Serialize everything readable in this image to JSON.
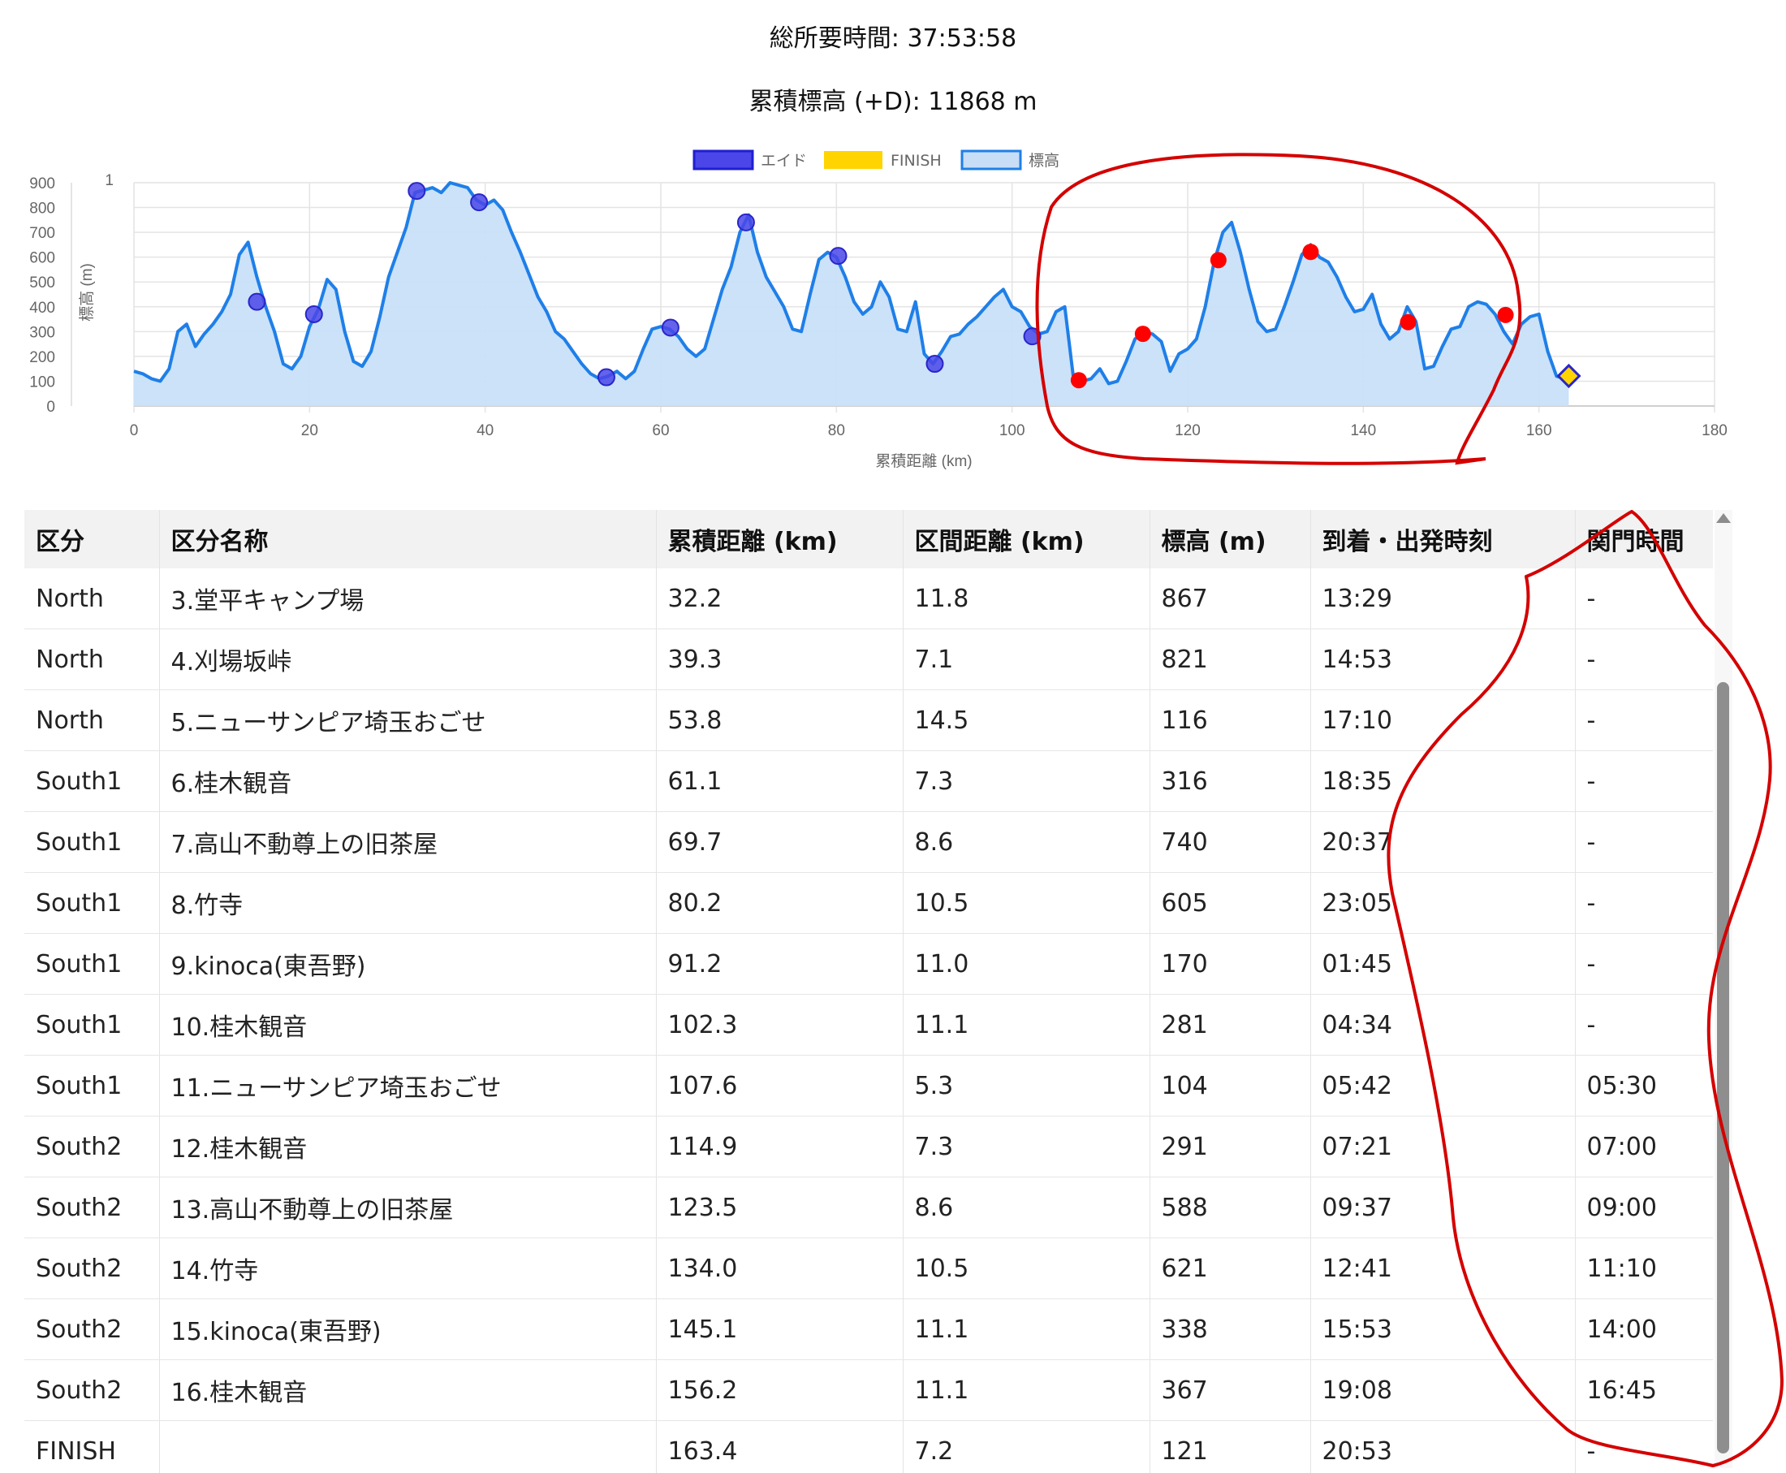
{
  "summary": {
    "total_time": "総所要時間: 37:53:58",
    "elevation_gain": "累積標高 (+D): 11868 m"
  },
  "chart": {
    "legend": [
      {
        "label": "エイド",
        "color": "#4a46e8"
      },
      {
        "label": "FINISH",
        "color": "#ffd400"
      },
      {
        "label": "標高",
        "color": "#c8def6"
      }
    ],
    "right_axis_tick": "1",
    "x_tick_labels": [
      "0",
      "20",
      "40",
      "60",
      "80",
      "100",
      "120",
      "140",
      "160",
      "180"
    ],
    "colors": {
      "line": "#1f7fe8",
      "fill": "#c8e0f8",
      "aid": "#4a46e8",
      "cutoff_aid": "#ff0000",
      "finish": "#ffd400"
    }
  },
  "chart_data": {
    "type": "area",
    "title": "",
    "xlabel": "累積距離 (km)",
    "ylabel": "標高 (m)",
    "xlim": [
      0,
      180
    ],
    "ylim": [
      0,
      900
    ],
    "y_ticks": [
      0,
      100,
      200,
      300,
      400,
      500,
      600,
      700,
      800,
      900
    ],
    "grid": true,
    "legend_position": "top",
    "series": [
      {
        "name": "標高",
        "x": [
          0,
          1,
          2,
          3,
          4,
          5,
          6,
          7,
          8,
          9,
          10,
          11,
          12,
          13,
          14,
          15,
          16,
          17,
          18,
          19,
          20,
          21,
          22,
          23,
          24,
          25,
          26,
          27,
          28,
          29,
          30,
          31,
          32,
          33,
          34,
          35,
          36,
          37,
          38,
          39,
          40,
          41,
          42,
          43,
          44,
          45,
          46,
          47,
          48,
          49,
          50,
          51,
          52,
          53,
          54,
          55,
          56,
          57,
          58,
          59,
          60,
          61,
          62,
          63,
          64,
          65,
          66,
          67,
          68,
          69,
          70,
          71,
          72,
          73,
          74,
          75,
          76,
          77,
          78,
          79,
          80,
          81,
          82,
          83,
          84,
          85,
          86,
          87,
          88,
          89,
          90,
          91,
          92,
          93,
          94,
          95,
          96,
          97,
          98,
          99,
          100,
          101,
          102,
          103,
          104,
          105,
          106,
          107,
          108,
          109,
          110,
          111,
          112,
          113,
          114,
          115,
          116,
          117,
          118,
          119,
          120,
          121,
          122,
          123,
          124,
          125,
          126,
          127,
          128,
          129,
          130,
          131,
          132,
          133,
          134,
          135,
          136,
          137,
          138,
          139,
          140,
          141,
          142,
          143,
          144,
          145,
          146,
          147,
          148,
          149,
          150,
          151,
          152,
          153,
          154,
          155,
          156,
          157,
          158,
          159,
          160,
          161,
          162,
          163,
          163.4
        ],
        "y": [
          140,
          130,
          110,
          100,
          150,
          300,
          330,
          240,
          290,
          330,
          380,
          450,
          610,
          660,
          520,
          400,
          300,
          170,
          150,
          200,
          320,
          390,
          510,
          470,
          300,
          180,
          160,
          220,
          360,
          520,
          620,
          720,
          860,
          870,
          880,
          860,
          900,
          890,
          880,
          830,
          810,
          830,
          790,
          700,
          620,
          530,
          440,
          380,
          300,
          270,
          220,
          170,
          130,
          110,
          120,
          140,
          110,
          140,
          230,
          310,
          320,
          310,
          280,
          230,
          200,
          230,
          350,
          470,
          560,
          700,
          770,
          620,
          520,
          460,
          400,
          310,
          300,
          450,
          590,
          620,
          600,
          520,
          420,
          370,
          400,
          500,
          440,
          310,
          300,
          420,
          210,
          170,
          220,
          280,
          290,
          330,
          360,
          400,
          440,
          470,
          400,
          380,
          320,
          290,
          300,
          380,
          400,
          110,
          100,
          110,
          150,
          90,
          100,
          180,
          270,
          300,
          290,
          260,
          140,
          210,
          230,
          270,
          400,
          580,
          700,
          740,
          620,
          470,
          340,
          300,
          310,
          400,
          500,
          610,
          650,
          600,
          580,
          520,
          440,
          380,
          390,
          450,
          330,
          270,
          300,
          400,
          340,
          150,
          160,
          240,
          310,
          320,
          400,
          420,
          410,
          370,
          300,
          250,
          330,
          360,
          370,
          220,
          120,
          110,
          121
        ]
      },
      {
        "name": "エイド",
        "x": [
          14,
          20.5,
          32.2,
          39.3,
          53.8,
          61.1,
          69.7,
          80.2,
          91.2,
          102.3
        ],
        "y": [
          420,
          370,
          867,
          821,
          116,
          316,
          740,
          605,
          170,
          281
        ]
      },
      {
        "name": "エイド (関門)",
        "x": [
          107.6,
          114.9,
          123.5,
          134.0,
          145.1,
          156.2
        ],
        "y": [
          104,
          291,
          588,
          621,
          338,
          367
        ]
      },
      {
        "name": "FINISH",
        "x": [
          163.4
        ],
        "y": [
          121
        ]
      }
    ]
  },
  "table": {
    "headers": [
      "区分",
      "区分名称",
      "累積距離 (km)",
      "区間距離 (km)",
      "標高 (m)",
      "到着・出発時刻",
      "関門時間"
    ],
    "rows": [
      [
        "North",
        "3.堂平キャンプ場",
        "32.2",
        "11.8",
        "867",
        "13:29",
        "-"
      ],
      [
        "North",
        "4.刈場坂峠",
        "39.3",
        "7.1",
        "821",
        "14:53",
        "-"
      ],
      [
        "North",
        "5.ニューサンピア埼玉おごせ",
        "53.8",
        "14.5",
        "116",
        "17:10",
        "-"
      ],
      [
        "South1",
        "6.桂木観音",
        "61.1",
        "7.3",
        "316",
        "18:35",
        "-"
      ],
      [
        "South1",
        "7.高山不動尊上の旧茶屋",
        "69.7",
        "8.6",
        "740",
        "20:37",
        "-"
      ],
      [
        "South1",
        "8.竹寺",
        "80.2",
        "10.5",
        "605",
        "23:05",
        "-"
      ],
      [
        "South1",
        "9.kinoca(東吾野)",
        "91.2",
        "11.0",
        "170",
        "01:45",
        "-"
      ],
      [
        "South1",
        "10.桂木観音",
        "102.3",
        "11.1",
        "281",
        "04:34",
        "-"
      ],
      [
        "South1",
        "11.ニューサンピア埼玉おごせ",
        "107.6",
        "5.3",
        "104",
        "05:42",
        "05:30"
      ],
      [
        "South2",
        "12.桂木観音",
        "114.9",
        "7.3",
        "291",
        "07:21",
        "07:00"
      ],
      [
        "South2",
        "13.高山不動尊上の旧茶屋",
        "123.5",
        "8.6",
        "588",
        "09:37",
        "09:00"
      ],
      [
        "South2",
        "14.竹寺",
        "134.0",
        "10.5",
        "621",
        "12:41",
        "11:10"
      ],
      [
        "South2",
        "15.kinoca(東吾野)",
        "145.1",
        "11.1",
        "338",
        "15:53",
        "14:00"
      ],
      [
        "South2",
        "16.桂木観音",
        "156.2",
        "11.1",
        "367",
        "19:08",
        "16:45"
      ],
      [
        "FINISH",
        "",
        "163.4",
        "7.2",
        "121",
        "20:53",
        "-"
      ]
    ]
  },
  "annotation_color": "#d40000"
}
